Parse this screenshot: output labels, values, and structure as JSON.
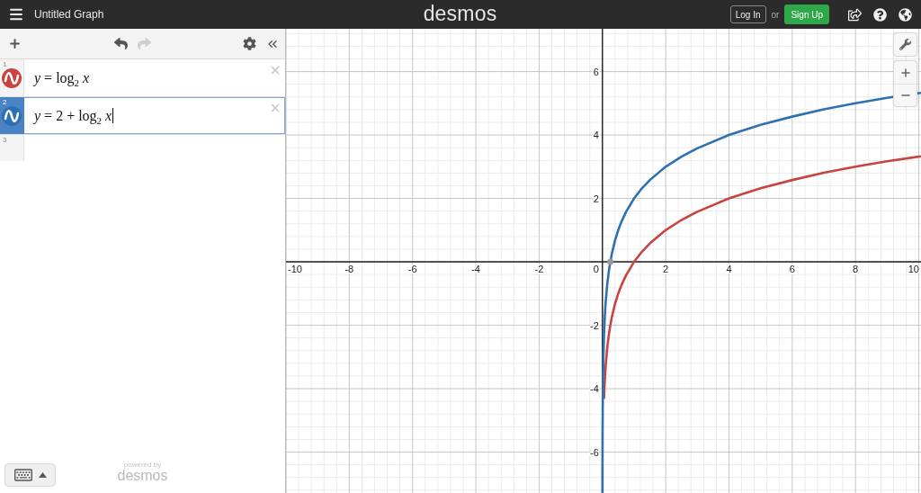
{
  "header": {
    "title": "Untitled Graph",
    "logo": "desmos",
    "login_label": "Log In",
    "or_label": "or",
    "signup_label": "Sign Up"
  },
  "toolbar": {
    "undo": {
      "disabled": false
    },
    "redo": {
      "disabled": true
    }
  },
  "expressions": [
    {
      "number": "1",
      "formula": "*y* = log$_{2}$ *x*",
      "color": "#c74440",
      "selected": false
    },
    {
      "number": "2",
      "formula": "*y* = 2 + log$_{2}$ *x*",
      "color": "#2d70b3",
      "selected": true
    },
    {
      "number": "3",
      "selected": false
    }
  ],
  "footer": {
    "powered_by": "powered by",
    "brand": "desmos"
  },
  "graph": {
    "chart_data": {
      "type": "line",
      "grid": true,
      "xlim": [
        -10,
        10.07
      ],
      "ylim": [
        -7.29,
        7.35
      ],
      "xticks": [
        -10,
        -8,
        -6,
        -4,
        -2,
        0,
        2,
        4,
        6,
        8,
        10
      ],
      "yticks": [
        -6,
        -4,
        -2,
        2,
        4,
        6
      ],
      "x": [
        0.0016,
        0.003,
        0.0063,
        0.01,
        0.015,
        0.02,
        0.03,
        0.05,
        0.075,
        0.1,
        0.15,
        0.2,
        0.25,
        0.3,
        0.4,
        0.5,
        0.6,
        0.75,
        1,
        1.25,
        1.5,
        2,
        2.5,
        3,
        4,
        5,
        6,
        7,
        8,
        9,
        10.07
      ],
      "series": [
        {
          "color": "#c74440",
          "values": [
            null,
            null,
            null,
            null,
            null,
            null,
            null,
            -4.32,
            -3.74,
            -3.32,
            -2.74,
            -2.32,
            -2,
            -1.74,
            -1.32,
            -1,
            -0.74,
            -0.42,
            0,
            0.32,
            0.58,
            1,
            1.32,
            1.58,
            2,
            2.32,
            2.58,
            2.81,
            3,
            3.17,
            3.33
          ]
        },
        {
          "color": "#2d70b3",
          "values": [
            -7.29,
            -6.38,
            -5.31,
            -4.64,
            -4.06,
            -3.64,
            -3.06,
            -2.32,
            -1.74,
            -1.32,
            -0.74,
            -0.32,
            0,
            0.26,
            0.68,
            1,
            1.26,
            1.58,
            2,
            2.32,
            2.58,
            3,
            3.32,
            3.58,
            4,
            4.32,
            4.58,
            4.81,
            5,
            5.17,
            5.33
          ]
        }
      ]
    }
  }
}
